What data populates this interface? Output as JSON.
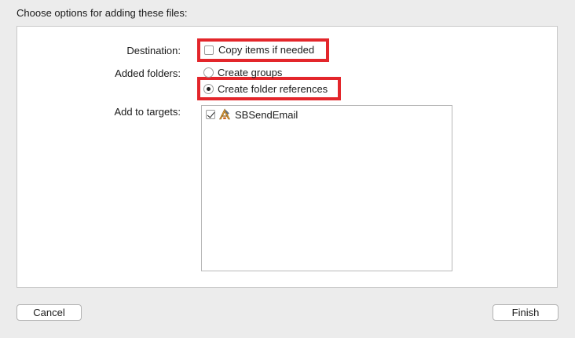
{
  "dialog": {
    "title": "Choose options for adding these files:"
  },
  "destination": {
    "label": "Destination:",
    "copy_items": {
      "label": "Copy items if needed",
      "checked": false
    }
  },
  "added_folders": {
    "label": "Added folders:",
    "options": [
      {
        "label": "Create groups",
        "selected": false
      },
      {
        "label": "Create folder references",
        "selected": true
      }
    ]
  },
  "targets": {
    "label": "Add to targets:",
    "items": [
      {
        "name": "SBSendEmail",
        "checked": true,
        "icon": "xcode-app-icon"
      }
    ]
  },
  "buttons": {
    "cancel": "Cancel",
    "finish": "Finish"
  },
  "colors": {
    "highlight": "#e3262b",
    "background": "#ececec"
  }
}
